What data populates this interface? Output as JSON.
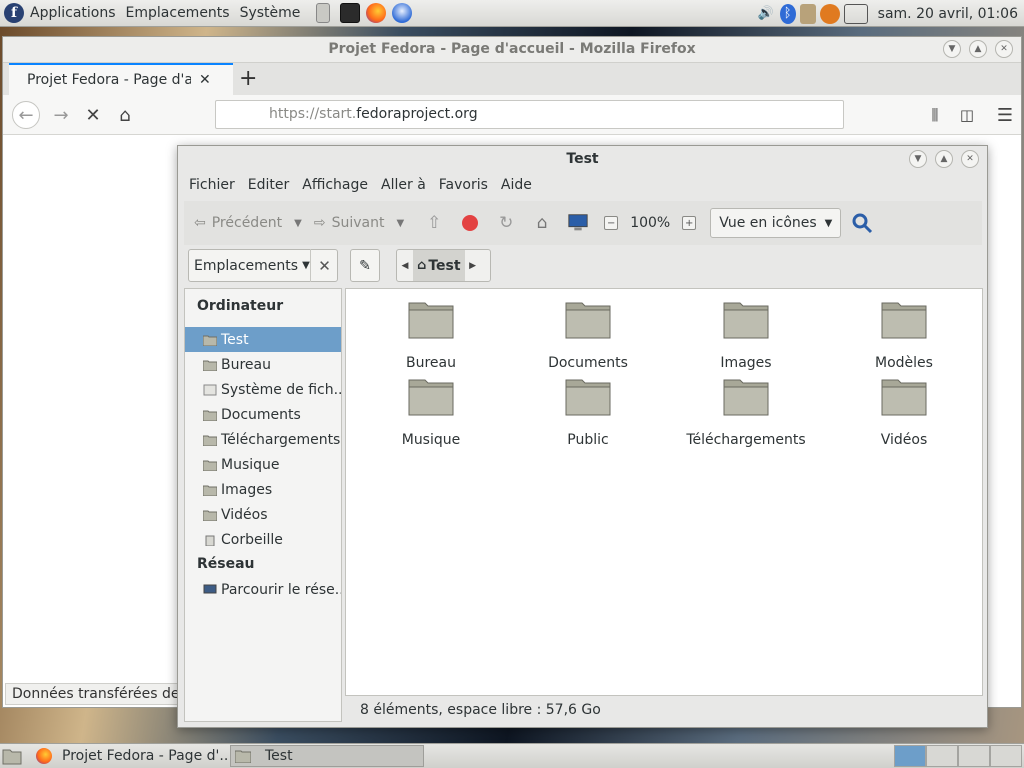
{
  "top_panel": {
    "menus": [
      "Applications",
      "Emplacements",
      "Système"
    ],
    "clock": "sam. 20 avril, 01:06",
    "tray_icons": [
      "volume-icon",
      "bluetooth-icon",
      "clipboard-icon",
      "updates-icon",
      "battery-icon"
    ]
  },
  "firefox": {
    "window_title": "Projet Fedora - Page d'accueil - Mozilla Firefox",
    "tab_label": "Projet Fedora - Page d'accueil",
    "url_proto": "https://start.",
    "url_host": "fedoraproject.org",
    "status_text": "Données transférées depuis"
  },
  "file_manager": {
    "window_title": "Test",
    "menus": [
      "Fichier",
      "Editer",
      "Affichage",
      "Aller à",
      "Favoris",
      "Aide"
    ],
    "toolbar": {
      "back": "Précédent",
      "forward": "Suivant",
      "zoom": "100%",
      "view_mode": "Vue en icônes"
    },
    "location": {
      "combo": "Emplacements",
      "crumb": "Test"
    },
    "sidebar": {
      "computer_header": "Ordinateur",
      "computer_items": [
        "Test",
        "Bureau",
        "Système de fich...",
        "Documents",
        "Téléchargements",
        "Musique",
        "Images",
        "Vidéos",
        "Corbeille"
      ],
      "network_header": "Réseau",
      "network_items": [
        "Parcourir le rése..."
      ]
    },
    "items": [
      "Bureau",
      "Documents",
      "Images",
      "Modèles",
      "Musique",
      "Public",
      "Téléchargements",
      "Vidéos"
    ],
    "status": "8 éléments, espace libre : 57,6 Go"
  },
  "taskbar": {
    "tasks": [
      "Projet Fedora - Page d'...",
      "Test"
    ]
  },
  "colors": {
    "selection": "#6d9ec9",
    "folder": "#a8a898",
    "firefox_accent": "#0a84ff"
  }
}
